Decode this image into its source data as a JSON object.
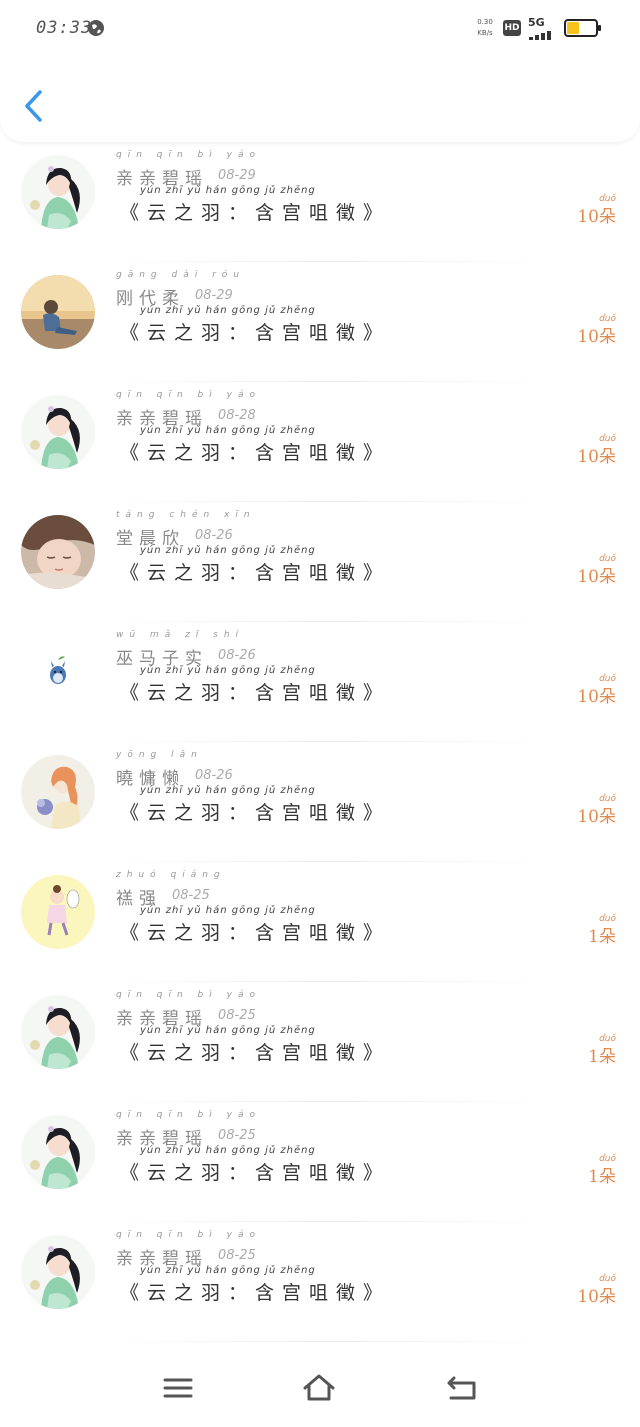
{
  "status_bar": {
    "time": "03:33",
    "net_speed_value": "0.30",
    "net_speed_unit": "KB/s",
    "hd": "HD",
    "network": "5G"
  },
  "icons": {
    "back": "chevron-left-icon",
    "menu": "menu-icon",
    "home": "home-icon",
    "return": "return-icon"
  },
  "colors": {
    "back_arrow": "#3a98e8",
    "count_text": "#e08a52",
    "battery_fill": "#f6c31c"
  },
  "rows": [
    {
      "name": "亲亲碧瑶",
      "name_pinyin": "qīn qīn bì yáo",
      "date": "08-29",
      "title": "《云之羽：含宫咀徵》",
      "title_pinyin": "yún zhī yǔ   hán gōng jǔ zhēng",
      "count": "10朵",
      "count_pinyin": "duǒ",
      "avatar": "girl"
    },
    {
      "name": "刚代柔",
      "name_pinyin": "gāng dài róu",
      "date": "08-29",
      "title": "《云之羽：含宫咀徵》",
      "title_pinyin": "yún zhī yǔ   hán gōng jǔ zhēng",
      "count": "10朵",
      "count_pinyin": "duǒ",
      "avatar": "sitting"
    },
    {
      "name": "亲亲碧瑶",
      "name_pinyin": "qīn qīn bì yáo",
      "date": "08-28",
      "title": "《云之羽：含宫咀徵》",
      "title_pinyin": "yún zhī yǔ   hán gōng jǔ zhēng",
      "count": "10朵",
      "count_pinyin": "duǒ",
      "avatar": "girl"
    },
    {
      "name": "堂晨欣",
      "name_pinyin": "táng chén xīn",
      "date": "08-26",
      "title": "《云之羽：含宫咀徵》",
      "title_pinyin": "yún zhī yǔ   hán gōng jǔ zhēng",
      "count": "10朵",
      "count_pinyin": "duǒ",
      "avatar": "sleeping"
    },
    {
      "name": "巫马子实",
      "name_pinyin": "wū mǎ zǐ shí",
      "date": "08-26",
      "title": "《云之羽：含宫咀徵》",
      "title_pinyin": "yún zhī yǔ   hán gōng jǔ zhēng",
      "count": "10朵",
      "count_pinyin": "duǒ",
      "avatar": "totoro"
    },
    {
      "name": "曉慵懒",
      "name_pinyin": "yōng lǎn",
      "date": "08-26",
      "title": "《云之羽：含宫咀徵》",
      "title_pinyin": "yún zhī yǔ   hán gōng jǔ zhēng",
      "count": "10朵",
      "count_pinyin": "duǒ",
      "avatar": "orange-hair"
    },
    {
      "name": "禚强",
      "name_pinyin": "zhuó qiáng",
      "date": "08-25",
      "title": "《云之羽：含宫咀徵》",
      "title_pinyin": "yún zhī yǔ   hán gōng jǔ zhēng",
      "count": "1朵",
      "count_pinyin": "duǒ",
      "avatar": "cartoon"
    },
    {
      "name": "亲亲碧瑶",
      "name_pinyin": "qīn qīn bì yáo",
      "date": "08-25",
      "title": "《云之羽：含宫咀徵》",
      "title_pinyin": "yún zhī yǔ   hán gōng jǔ zhēng",
      "count": "1朵",
      "count_pinyin": "duǒ",
      "avatar": "girl"
    },
    {
      "name": "亲亲碧瑶",
      "name_pinyin": "qīn qīn bì yáo",
      "date": "08-25",
      "title": "《云之羽：含宫咀徵》",
      "title_pinyin": "yún zhī yǔ   hán gōng jǔ zhēng",
      "count": "1朵",
      "count_pinyin": "duǒ",
      "avatar": "girl"
    },
    {
      "name": "亲亲碧瑶",
      "name_pinyin": "qīn qīn bì yáo",
      "date": "08-25",
      "title": "《云之羽：含宫咀徵》",
      "title_pinyin": "yún zhī yǔ   hán gōng jǔ zhēng",
      "count": "10朵",
      "count_pinyin": "duǒ",
      "avatar": "girl"
    }
  ]
}
